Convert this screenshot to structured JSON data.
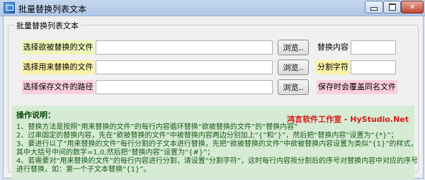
{
  "window": {
    "title": "批量替换列表文本"
  },
  "group": {
    "title": "批量替换列表文本"
  },
  "rows": {
    "source": {
      "label": "选择欲被替换的文件",
      "browse": "浏览.."
    },
    "replace": {
      "label": "选择用来替换的文件",
      "browse": "浏览.."
    },
    "save": {
      "label": "选择保存文件的路径",
      "browse": "浏览.."
    }
  },
  "right": {
    "replace_content_label": "替换内容",
    "split_char_label": "分割字符",
    "overwrite_note": "保存时会覆盖同名文件"
  },
  "instructions": {
    "title": "操作说明：",
    "brand": "鸿言软件工作室 - HyStudio.Net",
    "lines": [
      "1、替换方法是按照“用来替换的文件”的每行内容循环替换“欲被替换的文件”的“替换内容”",
      "2、过串固定的替换内容，先在“欲被替换的文件”中被替换内容两边分别加上“{”和“}”，然后把“替换内容”设置为“{*}”；",
      "3、要进行以了“用来替换的文件”每行分割的子文本进行替换，先把“欲被替换的文件”中欲被替换内容设置为类似“{1}”的样式，",
      "其中大括号中间的数字=1,0,然后把“替换内容”设置为“{#}”；",
      "4、若需要对“用来替换的文件”的每行内容进行分割，请设置“分割字符”，这时每行内容按分割后的序号对替换内容中对应的序号",
      "进行替换，如：第一个子文本替换“{1}”。"
    ]
  },
  "colors": {
    "label_green": "#f0f7b8",
    "label_yellow": "#fbf3a8",
    "label_pink": "#fbd0dc",
    "instructions_bg": "#d6ebd3",
    "brand_red": "#d81a1a"
  }
}
